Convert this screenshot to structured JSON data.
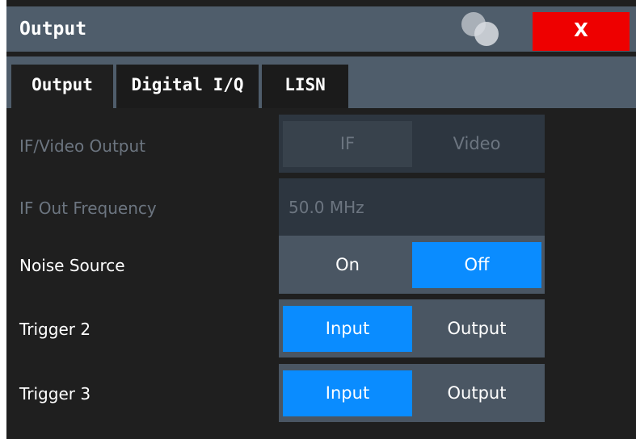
{
  "dialog": {
    "title": "Output",
    "close_label": "X"
  },
  "tabs": [
    {
      "label": "Output",
      "active": true
    },
    {
      "label": "Digital I/Q",
      "active": false
    },
    {
      "label": "LISN",
      "active": false
    }
  ],
  "if_video_output": {
    "label": "IF/Video Output",
    "options": [
      "IF",
      "Video"
    ],
    "selected": "IF",
    "enabled": false
  },
  "if_out_frequency": {
    "label": "IF Out Frequency",
    "value": "50.0 MHz",
    "enabled": false
  },
  "noise_source": {
    "label": "Noise Source",
    "options": [
      "On",
      "Off"
    ],
    "selected": "Off"
  },
  "trigger2": {
    "label": "Trigger 2",
    "options": [
      "Input",
      "Output"
    ],
    "selected": "Input"
  },
  "trigger3": {
    "label": "Trigger 3",
    "options": [
      "Input",
      "Output"
    ],
    "selected": "Input"
  },
  "colors": {
    "accent": "#0a8cff",
    "titlebar": "#4f5d6b",
    "close": "#ee0000",
    "background": "#1f1f1f"
  },
  "icons": {
    "close": "close-icon",
    "overlap": "overlapping-circles-icon"
  }
}
